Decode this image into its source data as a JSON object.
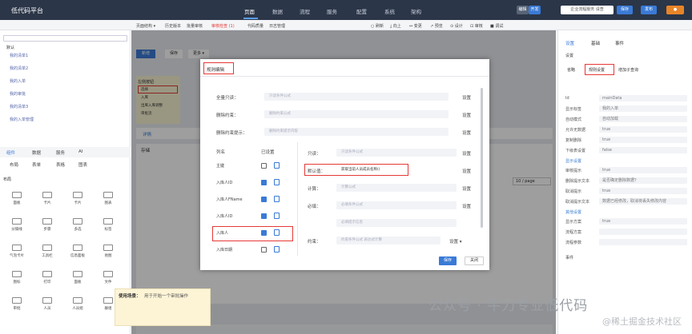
{
  "app_title": "低代码平台",
  "nav": [
    "页面",
    "数据",
    "流程",
    "服务",
    "配置",
    "系统",
    "架构"
  ],
  "top_right": {
    "toggle_a": "编辑",
    "toggle_b": "开发",
    "search_value": "企业流程服务 请查",
    "btn1": "保存",
    "btn2": "发布"
  },
  "toolbar2": {
    "left": [
      "页面结构 ▾",
      "历史版本",
      "批量审核",
      "审核检查 (1)",
      "代码质量",
      "日志管理"
    ],
    "right": [
      "○ 刷新",
      "⤓ 向上",
      "↔ 变更",
      "↗ 预览",
      "⊙ 设计",
      "⊡ 审核",
      "■ 调试"
    ]
  },
  "left_panel": {
    "root": "默认",
    "tree": [
      "我的清单1",
      "我的清单2",
      "我的入单",
      "我的审批",
      "我的清单3",
      "我的入单管理"
    ],
    "tabs": [
      "组件",
      "数据",
      "服务",
      "AI"
    ],
    "subtabs": [
      "布局",
      "表单",
      "表格",
      "图表"
    ],
    "section": "布局",
    "components": [
      "面板",
      "卡片",
      "卡片",
      "图表",
      "分隔线",
      "步骤",
      "多选",
      "标签",
      "气泡卡片",
      "工具栏",
      "信息面板",
      "地图",
      "图标",
      "打印",
      "面板",
      "文件",
      "审批",
      "人员",
      "人员组",
      "群组"
    ]
  },
  "canvas": {
    "btn_new": "新增",
    "btn_save": "保存",
    "btn_more": "更多 ▾",
    "row_label": "左侧按钮",
    "row1": "选择",
    "row2": "入库",
    "row3": "出库入库调整",
    "row4": "审批流",
    "tab1": "详情",
    "status": "存储",
    "pager": "10 / page"
  },
  "modal": {
    "title": "规则编辑",
    "top_fields": [
      {
        "label": "全量只读：",
        "placeholder": "只读条件公式"
      },
      {
        "label": "删除约束：",
        "placeholder": "删除约束公式"
      },
      {
        "label": "删除约束提示：",
        "placeholder": "删除约束提示内容"
      }
    ],
    "set_label": "设置",
    "col_header": "列名",
    "chk_header": "已设置",
    "columns": [
      {
        "name": "主键",
        "on": false
      },
      {
        "name": "入库人ID",
        "on": true
      },
      {
        "name": "入库人FName",
        "on": true
      },
      {
        "name": "入库人ID",
        "on": true
      },
      {
        "name": "入库人",
        "on": true
      },
      {
        "name": "入库日期",
        "on": false
      }
    ],
    "right_fields": [
      {
        "label": "只读：",
        "placeholder": "只读条件公式"
      },
      {
        "label": "默认值：",
        "value": "获取当前人员成员名称()"
      },
      {
        "label": "计算：",
        "placeholder": "计算公式"
      },
      {
        "label": "必填：",
        "placeholder": "必填条件公式"
      },
      {
        "label": "",
        "placeholder": "必填提示信息"
      },
      {
        "label": "约束：",
        "placeholder": "约束条件公式 表达式计算"
      }
    ],
    "save": "保存",
    "close": "关闭"
  },
  "tip": {
    "title": "使用场景：",
    "text": "用于开始一个审批操作"
  },
  "right_panel": {
    "tabs": [
      "设置",
      "基础",
      "事件"
    ],
    "sub_tabs": [
      "省略",
      "规则设置",
      "增加子查询"
    ],
    "group1": "设置",
    "props": [
      {
        "k": "Id",
        "v": "mainData"
      },
      {
        "k": "显示标签",
        "v": "我的入单"
      },
      {
        "k": "自动模式",
        "v": "自动加载"
      },
      {
        "k": "允许无数据",
        "v": "true"
      },
      {
        "k": "复制删除",
        "v": "true"
      },
      {
        "k": "下级表设置",
        "v": "false"
      }
    ],
    "group2": "显示设置",
    "props2": [
      {
        "k": "审核提示",
        "v": "true"
      },
      {
        "k": "删除提示文本",
        "v": "是否确定删除数据？"
      },
      {
        "k": "取消提示",
        "v": "true"
      },
      {
        "k": "取消提示文本",
        "v": "数据已经修改，取消将丢失修改内容"
      }
    ],
    "group3": "其他设置",
    "props3": [
      {
        "k": "显示方案",
        "v": "true"
      },
      {
        "k": "流程方案",
        "v": ""
      },
      {
        "k": "流程参数",
        "v": ""
      }
    ],
    "group4": "事件"
  },
  "watermark": "公众号 · 牛刀专业低代码",
  "watermark2": "@稀土掘金技术社区"
}
